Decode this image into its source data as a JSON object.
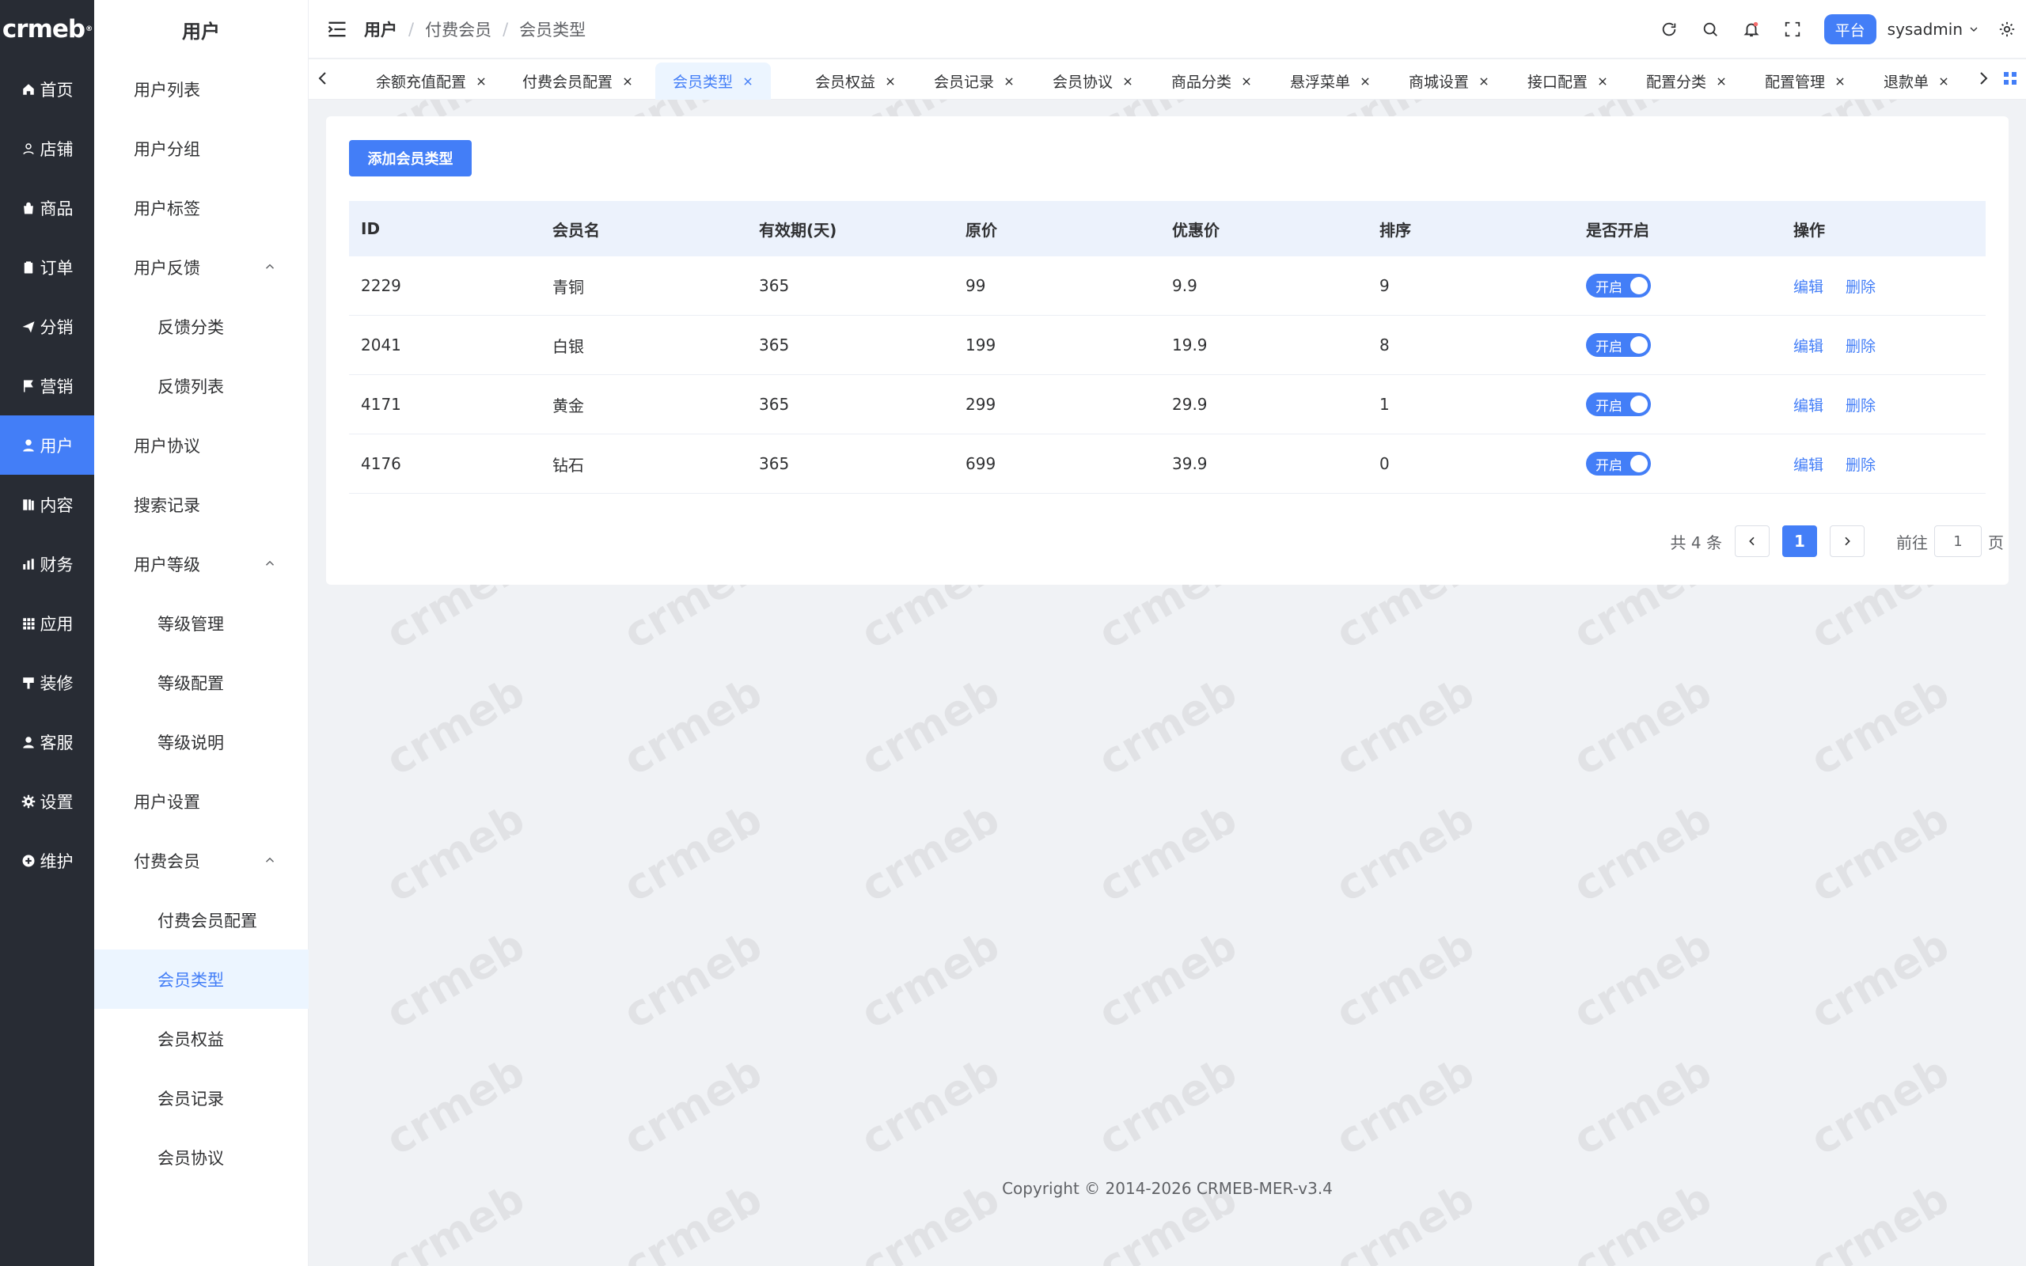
{
  "logo": "crmeb",
  "rail": [
    {
      "label": "首页",
      "icon": "home-icon"
    },
    {
      "label": "店铺",
      "icon": "store-icon"
    },
    {
      "label": "商品",
      "icon": "bag-icon"
    },
    {
      "label": "订单",
      "icon": "clipboard-icon"
    },
    {
      "label": "分销",
      "icon": "send-icon"
    },
    {
      "label": "营销",
      "icon": "flag-icon"
    },
    {
      "label": "用户",
      "icon": "user-icon",
      "active": true
    },
    {
      "label": "内容",
      "icon": "book-icon"
    },
    {
      "label": "财务",
      "icon": "bar-chart-icon"
    },
    {
      "label": "应用",
      "icon": "grid-icon"
    },
    {
      "label": "装修",
      "icon": "brush-icon"
    },
    {
      "label": "客服",
      "icon": "support-icon"
    },
    {
      "label": "设置",
      "icon": "gear-icon"
    },
    {
      "label": "维护",
      "icon": "plus-circle-icon"
    }
  ],
  "submenu": {
    "title": "用户",
    "items": [
      {
        "label": "用户列表",
        "level": 1
      },
      {
        "label": "用户分组",
        "level": 1
      },
      {
        "label": "用户标签",
        "level": 1
      },
      {
        "label": "用户反馈",
        "level": 1,
        "expanded": true
      },
      {
        "label": "反馈分类",
        "level": 2
      },
      {
        "label": "反馈列表",
        "level": 2
      },
      {
        "label": "用户协议",
        "level": 1
      },
      {
        "label": "搜索记录",
        "level": 1
      },
      {
        "label": "用户等级",
        "level": 1,
        "expanded": true
      },
      {
        "label": "等级管理",
        "level": 2
      },
      {
        "label": "等级配置",
        "level": 2
      },
      {
        "label": "等级说明",
        "level": 2
      },
      {
        "label": "用户设置",
        "level": 1
      },
      {
        "label": "付费会员",
        "level": 1,
        "expanded": true
      },
      {
        "label": "付费会员配置",
        "level": 2
      },
      {
        "label": "会员类型",
        "level": 2,
        "active": true
      },
      {
        "label": "会员权益",
        "level": 2
      },
      {
        "label": "会员记录",
        "level": 2
      },
      {
        "label": "会员协议",
        "level": 2
      }
    ]
  },
  "header": {
    "breadcrumb": [
      "用户",
      "付费会员",
      "会员类型"
    ],
    "platform": "平台",
    "username": "sysadmin"
  },
  "tabs": [
    {
      "label": "余额充值配置"
    },
    {
      "label": "付费会员配置"
    },
    {
      "label": "会员类型",
      "active": true
    },
    {
      "label": "会员权益"
    },
    {
      "label": "会员记录"
    },
    {
      "label": "会员协议"
    },
    {
      "label": "商品分类"
    },
    {
      "label": "悬浮菜单"
    },
    {
      "label": "商城设置"
    },
    {
      "label": "接口配置"
    },
    {
      "label": "配置分类"
    },
    {
      "label": "配置管理"
    },
    {
      "label": "退款单"
    }
  ],
  "toolbar": {
    "add_label": "添加会员类型"
  },
  "table": {
    "columns": [
      "ID",
      "会员名",
      "有效期(天)",
      "原价",
      "优惠价",
      "排序",
      "是否开启",
      "操作"
    ],
    "rows": [
      {
        "id": "2229",
        "name": "青铜",
        "days": "365",
        "price": "99",
        "discount": "9.9",
        "sort": "9",
        "status": "开启"
      },
      {
        "id": "2041",
        "name": "白银",
        "days": "365",
        "price": "199",
        "discount": "19.9",
        "sort": "8",
        "status": "开启"
      },
      {
        "id": "4171",
        "name": "黄金",
        "days": "365",
        "price": "299",
        "discount": "29.9",
        "sort": "1",
        "status": "开启"
      },
      {
        "id": "4176",
        "name": "钻石",
        "days": "365",
        "price": "699",
        "discount": "39.9",
        "sort": "0",
        "status": "开启"
      }
    ],
    "edit_label": "编辑",
    "delete_label": "删除"
  },
  "pager": {
    "total": "共 4 条",
    "current": "1",
    "goto_label": "前往",
    "goto_value": "1",
    "page_suffix": "页"
  },
  "footer": "Copyright © 2014-2026 CRMEB-MER-v3.4",
  "colors": {
    "primary": "#437ef7",
    "rail_bg": "#282c34",
    "page_bg": "#f0f2f5"
  }
}
